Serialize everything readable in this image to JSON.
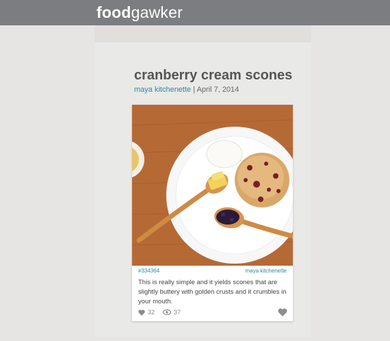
{
  "header": {
    "logo_bold": "food",
    "logo_light": "gawker"
  },
  "post": {
    "title": "cranberry cream scones",
    "author": "maya kitchenette",
    "separator": "|",
    "date": "April 7, 2014"
  },
  "card": {
    "pin_id": "#334364",
    "site": "maya kitchenette",
    "description": "This is really simple and it yields scones that are slightly buttery with golden crusts and it crumbles in your mouth.",
    "likes": "32",
    "views": "37"
  },
  "colors": {
    "topbar": "#7b7d80",
    "accent": "#2a8aa0",
    "background": "#e6e5e3"
  }
}
